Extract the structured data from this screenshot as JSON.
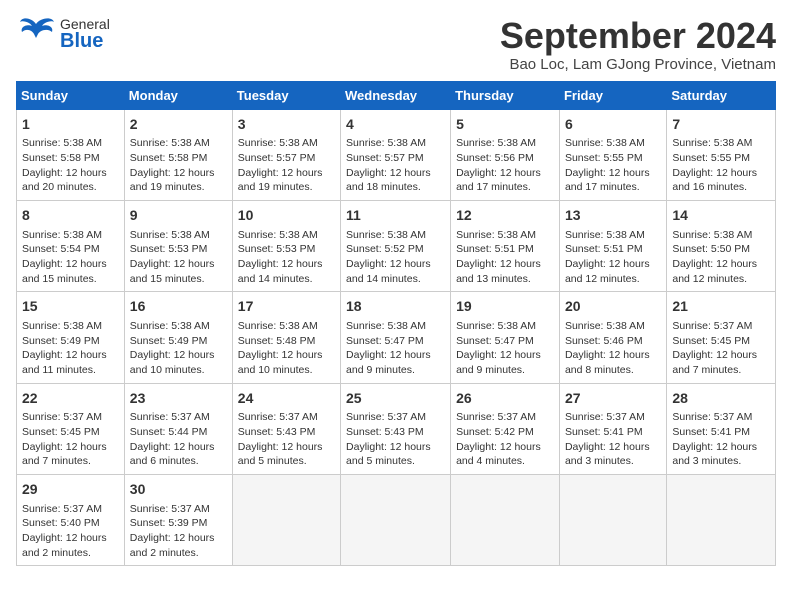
{
  "header": {
    "title": "September 2024",
    "subtitle": "Bao Loc, Lam GJong Province, Vietnam",
    "logo_general": "General",
    "logo_blue": "Blue"
  },
  "calendar": {
    "days_of_week": [
      "Sunday",
      "Monday",
      "Tuesday",
      "Wednesday",
      "Thursday",
      "Friday",
      "Saturday"
    ],
    "weeks": [
      [
        {
          "day": "",
          "empty": true
        },
        {
          "day": "",
          "empty": true
        },
        {
          "day": "",
          "empty": true
        },
        {
          "day": "",
          "empty": true
        },
        {
          "day": "",
          "empty": true
        },
        {
          "day": "",
          "empty": true
        },
        {
          "day": "",
          "empty": true
        }
      ],
      [
        {
          "day": "1",
          "sunrise": "Sunrise: 5:38 AM",
          "sunset": "Sunset: 5:58 PM",
          "daylight": "Daylight: 12 hours and 20 minutes."
        },
        {
          "day": "2",
          "sunrise": "Sunrise: 5:38 AM",
          "sunset": "Sunset: 5:58 PM",
          "daylight": "Daylight: 12 hours and 19 minutes."
        },
        {
          "day": "3",
          "sunrise": "Sunrise: 5:38 AM",
          "sunset": "Sunset: 5:57 PM",
          "daylight": "Daylight: 12 hours and 19 minutes."
        },
        {
          "day": "4",
          "sunrise": "Sunrise: 5:38 AM",
          "sunset": "Sunset: 5:57 PM",
          "daylight": "Daylight: 12 hours and 18 minutes."
        },
        {
          "day": "5",
          "sunrise": "Sunrise: 5:38 AM",
          "sunset": "Sunset: 5:56 PM",
          "daylight": "Daylight: 12 hours and 17 minutes."
        },
        {
          "day": "6",
          "sunrise": "Sunrise: 5:38 AM",
          "sunset": "Sunset: 5:55 PM",
          "daylight": "Daylight: 12 hours and 17 minutes."
        },
        {
          "day": "7",
          "sunrise": "Sunrise: 5:38 AM",
          "sunset": "Sunset: 5:55 PM",
          "daylight": "Daylight: 12 hours and 16 minutes."
        }
      ],
      [
        {
          "day": "8",
          "sunrise": "Sunrise: 5:38 AM",
          "sunset": "Sunset: 5:54 PM",
          "daylight": "Daylight: 12 hours and 15 minutes."
        },
        {
          "day": "9",
          "sunrise": "Sunrise: 5:38 AM",
          "sunset": "Sunset: 5:53 PM",
          "daylight": "Daylight: 12 hours and 15 minutes."
        },
        {
          "day": "10",
          "sunrise": "Sunrise: 5:38 AM",
          "sunset": "Sunset: 5:53 PM",
          "daylight": "Daylight: 12 hours and 14 minutes."
        },
        {
          "day": "11",
          "sunrise": "Sunrise: 5:38 AM",
          "sunset": "Sunset: 5:52 PM",
          "daylight": "Daylight: 12 hours and 14 minutes."
        },
        {
          "day": "12",
          "sunrise": "Sunrise: 5:38 AM",
          "sunset": "Sunset: 5:51 PM",
          "daylight": "Daylight: 12 hours and 13 minutes."
        },
        {
          "day": "13",
          "sunrise": "Sunrise: 5:38 AM",
          "sunset": "Sunset: 5:51 PM",
          "daylight": "Daylight: 12 hours and 12 minutes."
        },
        {
          "day": "14",
          "sunrise": "Sunrise: 5:38 AM",
          "sunset": "Sunset: 5:50 PM",
          "daylight": "Daylight: 12 hours and 12 minutes."
        }
      ],
      [
        {
          "day": "15",
          "sunrise": "Sunrise: 5:38 AM",
          "sunset": "Sunset: 5:49 PM",
          "daylight": "Daylight: 12 hours and 11 minutes."
        },
        {
          "day": "16",
          "sunrise": "Sunrise: 5:38 AM",
          "sunset": "Sunset: 5:49 PM",
          "daylight": "Daylight: 12 hours and 10 minutes."
        },
        {
          "day": "17",
          "sunrise": "Sunrise: 5:38 AM",
          "sunset": "Sunset: 5:48 PM",
          "daylight": "Daylight: 12 hours and 10 minutes."
        },
        {
          "day": "18",
          "sunrise": "Sunrise: 5:38 AM",
          "sunset": "Sunset: 5:47 PM",
          "daylight": "Daylight: 12 hours and 9 minutes."
        },
        {
          "day": "19",
          "sunrise": "Sunrise: 5:38 AM",
          "sunset": "Sunset: 5:47 PM",
          "daylight": "Daylight: 12 hours and 9 minutes."
        },
        {
          "day": "20",
          "sunrise": "Sunrise: 5:38 AM",
          "sunset": "Sunset: 5:46 PM",
          "daylight": "Daylight: 12 hours and 8 minutes."
        },
        {
          "day": "21",
          "sunrise": "Sunrise: 5:37 AM",
          "sunset": "Sunset: 5:45 PM",
          "daylight": "Daylight: 12 hours and 7 minutes."
        }
      ],
      [
        {
          "day": "22",
          "sunrise": "Sunrise: 5:37 AM",
          "sunset": "Sunset: 5:45 PM",
          "daylight": "Daylight: 12 hours and 7 minutes."
        },
        {
          "day": "23",
          "sunrise": "Sunrise: 5:37 AM",
          "sunset": "Sunset: 5:44 PM",
          "daylight": "Daylight: 12 hours and 6 minutes."
        },
        {
          "day": "24",
          "sunrise": "Sunrise: 5:37 AM",
          "sunset": "Sunset: 5:43 PM",
          "daylight": "Daylight: 12 hours and 5 minutes."
        },
        {
          "day": "25",
          "sunrise": "Sunrise: 5:37 AM",
          "sunset": "Sunset: 5:43 PM",
          "daylight": "Daylight: 12 hours and 5 minutes."
        },
        {
          "day": "26",
          "sunrise": "Sunrise: 5:37 AM",
          "sunset": "Sunset: 5:42 PM",
          "daylight": "Daylight: 12 hours and 4 minutes."
        },
        {
          "day": "27",
          "sunrise": "Sunrise: 5:37 AM",
          "sunset": "Sunset: 5:41 PM",
          "daylight": "Daylight: 12 hours and 3 minutes."
        },
        {
          "day": "28",
          "sunrise": "Sunrise: 5:37 AM",
          "sunset": "Sunset: 5:41 PM",
          "daylight": "Daylight: 12 hours and 3 minutes."
        }
      ],
      [
        {
          "day": "29",
          "sunrise": "Sunrise: 5:37 AM",
          "sunset": "Sunset: 5:40 PM",
          "daylight": "Daylight: 12 hours and 2 minutes."
        },
        {
          "day": "30",
          "sunrise": "Sunrise: 5:37 AM",
          "sunset": "Sunset: 5:39 PM",
          "daylight": "Daylight: 12 hours and 2 minutes."
        },
        {
          "day": "",
          "empty": true
        },
        {
          "day": "",
          "empty": true
        },
        {
          "day": "",
          "empty": true
        },
        {
          "day": "",
          "empty": true
        },
        {
          "day": "",
          "empty": true
        }
      ]
    ]
  }
}
